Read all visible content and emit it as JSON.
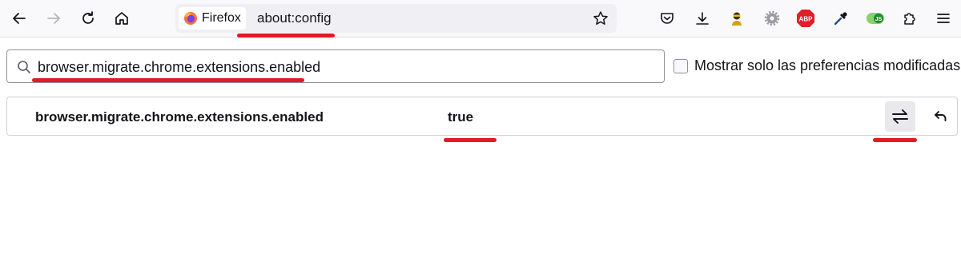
{
  "toolbar": {
    "identity_label": "Firefox",
    "url": "about:config",
    "extensions": [
      {
        "name": "pocket-icon"
      },
      {
        "name": "downloads-icon"
      },
      {
        "name": "extension-avatar-icon"
      },
      {
        "name": "settings-extension-icon"
      },
      {
        "name": "adblock-plus-icon",
        "text": "ABP"
      },
      {
        "name": "eyedropper-icon"
      },
      {
        "name": "javascript-toggle-icon",
        "text": "JS"
      },
      {
        "name": "extensions-puzzle-icon"
      },
      {
        "name": "menu-icon"
      }
    ]
  },
  "search": {
    "value": "browser.migrate.chrome.extensions.enabled"
  },
  "filter": {
    "label": "Mostrar solo las preferencias modificadas",
    "checked": false
  },
  "preference": {
    "name": "browser.migrate.chrome.extensions.enabled",
    "value": "true"
  },
  "colors": {
    "highlight": "#e01b24",
    "toolbar_bg": "#f9f9fb",
    "urlbar_bg": "#f0f0f4",
    "text": "#15141a"
  }
}
